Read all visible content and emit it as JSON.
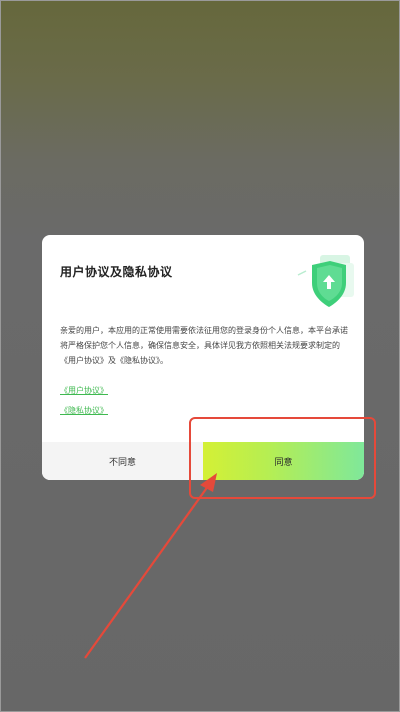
{
  "dialog": {
    "title": "用户协议及隐私协议",
    "body": "亲爱的用户，本应用的正常使用需要依法征用您的登录身份个人信息，本平台承诺将严格保护您个人信息，确保信息安全，具体详见我方依照相关法规要求制定的《用户协议》及《隐私协议》。",
    "link_user_agreement": "《用户协议》",
    "link_privacy_agreement": "《隐私协议》",
    "disagree_label": "不同意",
    "agree_label": "同意"
  },
  "colors": {
    "link": "#3fb950",
    "annotation": "#e5493a",
    "agree_gradient_start": "#d4f035",
    "agree_gradient_end": "#7fe89a",
    "shield": "#3ecf7a"
  },
  "icons": {
    "shield": "shield-check-icon"
  }
}
